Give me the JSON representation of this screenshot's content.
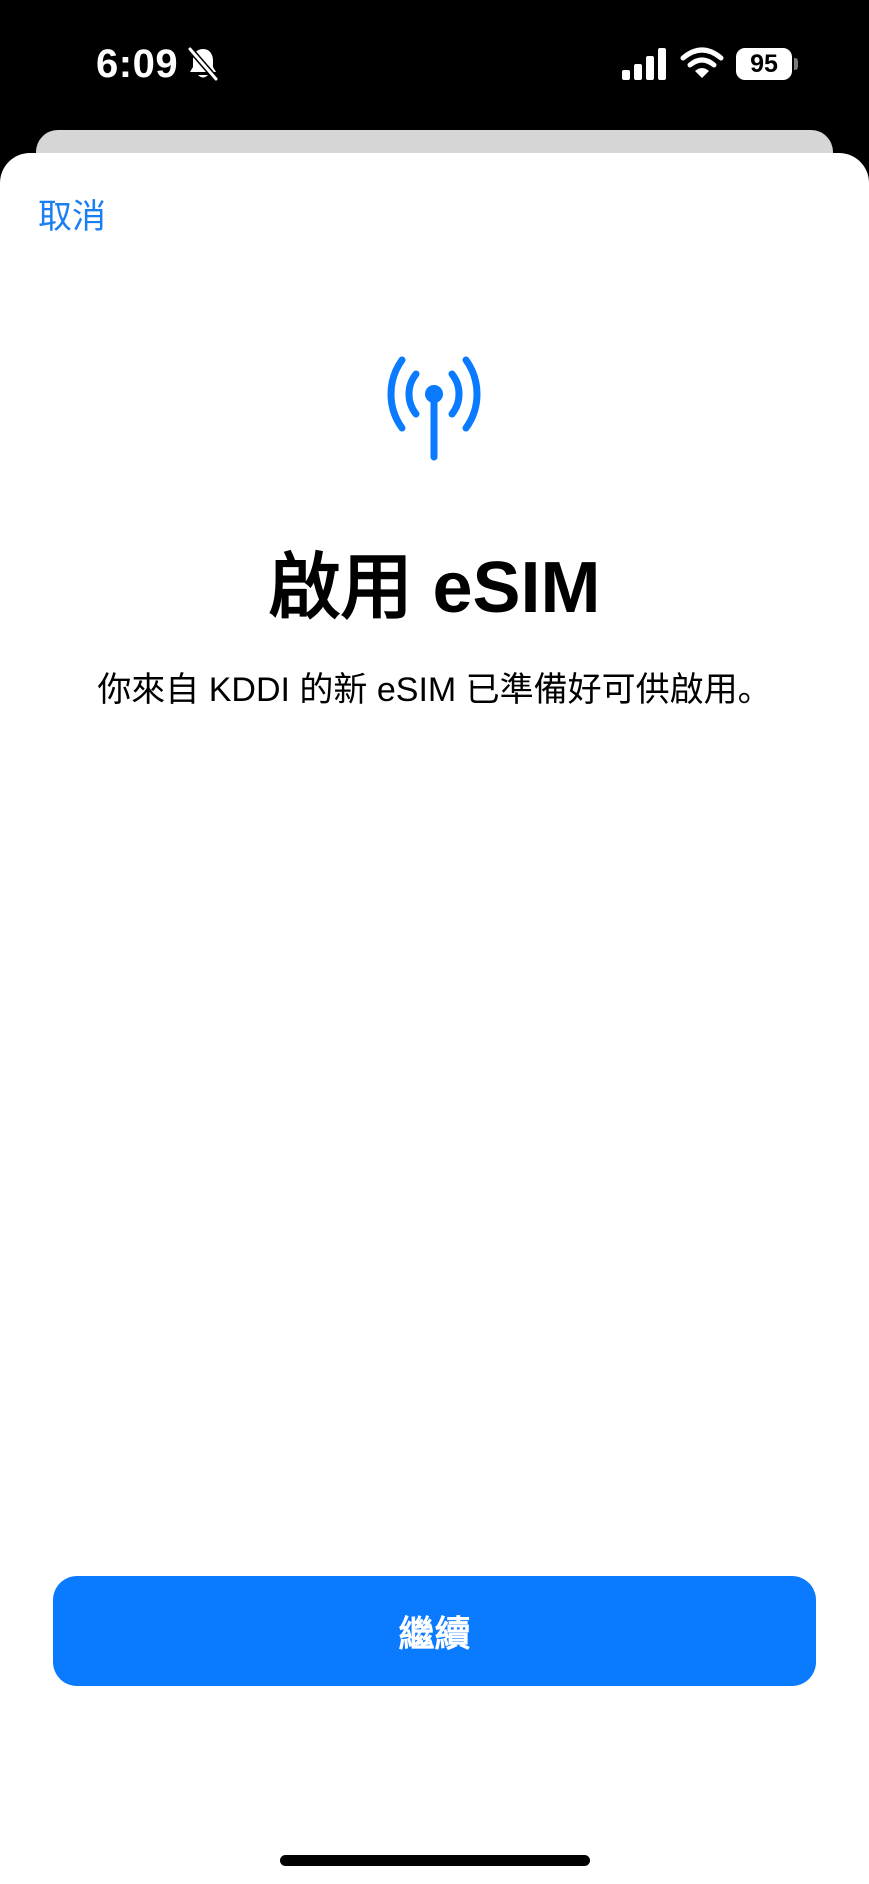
{
  "status_bar": {
    "time": "6:09",
    "battery_level": "95",
    "icons": [
      "bell-slash-icon",
      "cellular-signal-icon",
      "wifi-icon",
      "battery-icon"
    ]
  },
  "sheet": {
    "cancel_label": "取消",
    "icon": "antenna-icon",
    "title": "啟用 eSIM",
    "subtitle": "你來自 KDDI 的新 eSIM 已準備好可供啟用。",
    "continue_label": "繼續"
  },
  "colors": {
    "accent": "#0a7aff",
    "link": "#1a7ff3",
    "background": "#ffffff",
    "status_bar": "#000000"
  }
}
